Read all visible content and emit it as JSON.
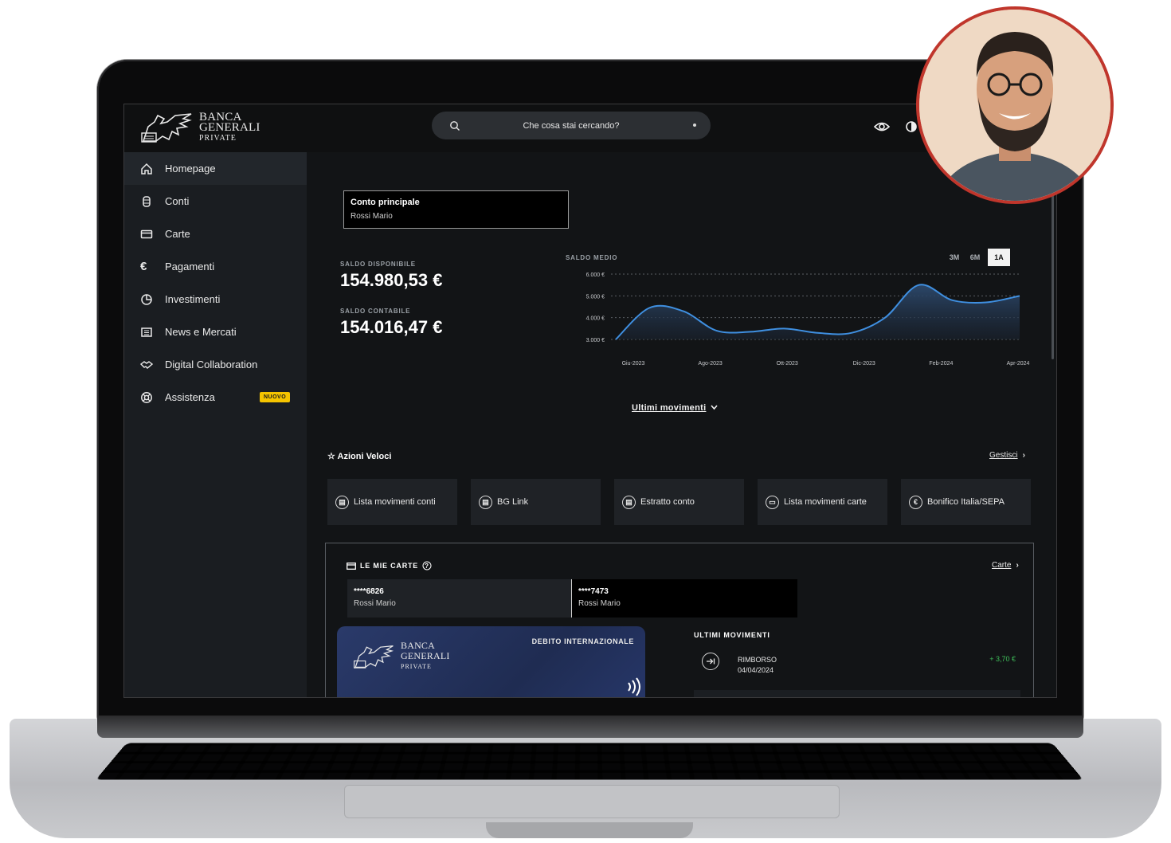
{
  "header": {
    "logo": {
      "line1": "BANCA",
      "line2": "GENERALI",
      "line3": "PRIVATE"
    },
    "search": {
      "placeholder": "Che cosa stai cercando?"
    }
  },
  "sidebar": {
    "items": [
      {
        "label": "Homepage",
        "icon": "home-icon"
      },
      {
        "label": "Conti",
        "icon": "coins-icon"
      },
      {
        "label": "Carte",
        "icon": "card-icon"
      },
      {
        "label": "Pagamenti",
        "icon": "euro-icon"
      },
      {
        "label": "Investimenti",
        "icon": "pie-chart-icon"
      },
      {
        "label": "News e Mercati",
        "icon": "newspaper-icon"
      },
      {
        "label": "Digital Collaboration",
        "icon": "handshake-icon"
      },
      {
        "label": "Assistenza",
        "icon": "lifebuoy-icon",
        "badge": "NUOVO"
      }
    ]
  },
  "account": {
    "title": "Conto principale",
    "holder": "Rossi Mario"
  },
  "balances": {
    "available_label": "SALDO DISPONIBILE",
    "available_value": "154.980,53 €",
    "accounting_label": "SALDO CONTABILE",
    "accounting_value": "154.016,47 €"
  },
  "chart_data": {
    "type": "area",
    "title": "SALDO MEDIO",
    "periods": [
      "3M",
      "6M",
      "1A"
    ],
    "selected_period": "1A",
    "yticks": [
      "3.000 €",
      "4.000 €",
      "5.000 €",
      "6.000 €"
    ],
    "ytick_values": [
      3000,
      4000,
      5000,
      6000
    ],
    "xticks": [
      "Giu-2023",
      "Ago-2023",
      "Ott-2023",
      "Dic-2023",
      "Feb-2024",
      "Apr-2024"
    ],
    "ylim": [
      3000,
      6000
    ],
    "grid": true,
    "series": [
      {
        "values": [
          3000,
          4450,
          4300,
          3400,
          3350,
          3500,
          3300,
          3300,
          4000,
          5500,
          4800,
          4700,
          5000
        ]
      }
    ],
    "accent": "#3f8fe0"
  },
  "last_movements_link": "Ultimi movimenti",
  "quick_actions": {
    "title": "Azioni Veloci",
    "manage": "Gestisci",
    "items": [
      {
        "label": "Lista movimenti conti",
        "icon": "coins-icon"
      },
      {
        "label": "BG Link",
        "icon": "coins-icon"
      },
      {
        "label": "Estratto conto",
        "icon": "coins-icon"
      },
      {
        "label": "Lista movimenti carte",
        "icon": "card-icon"
      },
      {
        "label": "Bonifico Italia/SEPA",
        "icon": "euro-icon"
      }
    ]
  },
  "cards": {
    "title": "LE MIE CARTE",
    "link": "Carte",
    "tabs": [
      {
        "number": "****6826",
        "holder": "Rossi Mario"
      },
      {
        "number": "****7473",
        "holder": "Rossi Mario"
      }
    ],
    "card_type": "DEBITO INTERNAZIONALE",
    "card_logo": {
      "line1": "BANCA",
      "line2": "GENERALI",
      "line3": "PRIVATE"
    },
    "movements_title": "ULTIMI MOVIMENTI",
    "movements": [
      {
        "description": "RIMBORSO",
        "date": "04/04/2024",
        "amount": "+ 3,70 €"
      }
    ]
  },
  "colors": {
    "accent": "#3f8fe0",
    "badge": "#f5c400",
    "positive": "#3fbf5a",
    "avatar_ring": "#c0362c"
  }
}
